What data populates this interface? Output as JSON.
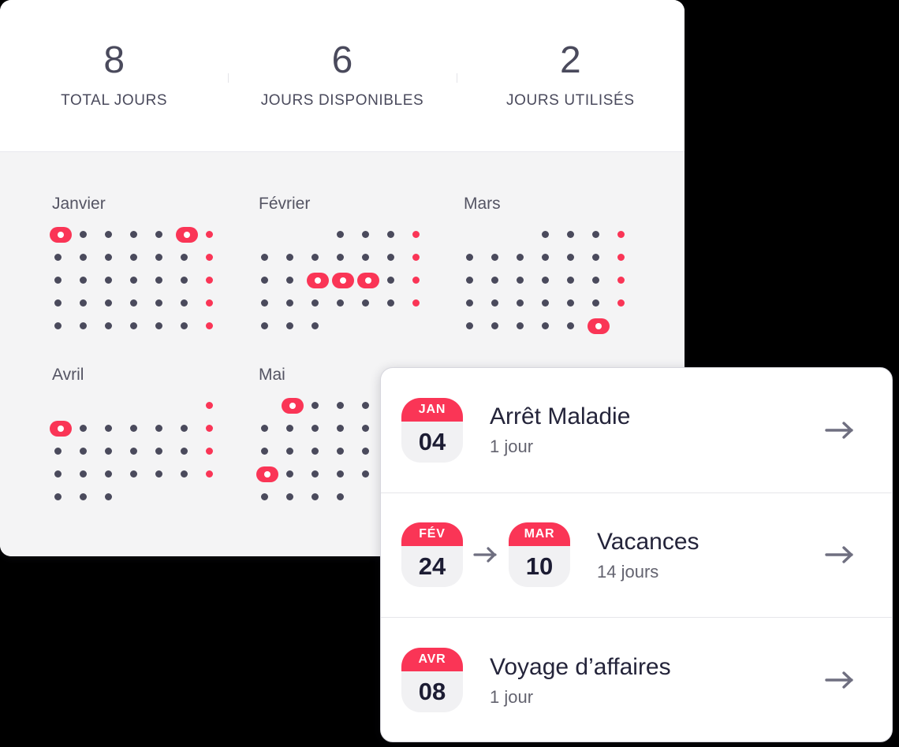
{
  "colors": {
    "accent": "#fa3556",
    "dot": "#4a4a5c",
    "panel_bg": "#f4f4f5",
    "card_bg": "#ffffff",
    "text_dark": "#24243a",
    "text_muted": "#63636f",
    "badge_body": "#f1f1f3"
  },
  "stats": [
    {
      "value": "8",
      "label": "TOTAL JOURS"
    },
    {
      "value": "6",
      "label": "JOURS DISPONIBLES"
    },
    {
      "value": "2",
      "label": "JOURS UTILISÉS"
    }
  ],
  "months": [
    {
      "name": "Janvier",
      "rows": [
        [
          "d",
          "d",
          "d",
          "d",
          "d",
          "d",
          "w"
        ],
        [
          "d",
          "d",
          "d",
          "d",
          "d",
          "d",
          "w"
        ],
        [
          "d",
          "d",
          "d",
          "d",
          "d",
          "d",
          "w"
        ],
        [
          "d",
          "d",
          "d",
          "d",
          "d",
          "d",
          "w"
        ],
        [
          "d",
          "d",
          "d",
          "d",
          "d",
          "d",
          "w"
        ]
      ],
      "highlights": [
        [
          0,
          0
        ],
        [
          0,
          5
        ]
      ]
    },
    {
      "name": "Février",
      "rows": [
        [
          "-",
          "-",
          "-",
          "d",
          "d",
          "d",
          "w"
        ],
        [
          "d",
          "d",
          "d",
          "d",
          "d",
          "d",
          "w"
        ],
        [
          "d",
          "d",
          "d",
          "d",
          "d",
          "d",
          "w"
        ],
        [
          "d",
          "d",
          "d",
          "d",
          "d",
          "d",
          "w"
        ],
        [
          "d",
          "d",
          "d",
          "-",
          "-",
          "-",
          "-"
        ]
      ],
      "highlights": [
        [
          2,
          2
        ],
        [
          2,
          3
        ],
        [
          2,
          4
        ]
      ]
    },
    {
      "name": "Mars",
      "rows": [
        [
          "-",
          "-",
          "-",
          "d",
          "d",
          "d",
          "w"
        ],
        [
          "d",
          "d",
          "d",
          "d",
          "d",
          "d",
          "w"
        ],
        [
          "d",
          "d",
          "d",
          "d",
          "d",
          "d",
          "w"
        ],
        [
          "d",
          "d",
          "d",
          "d",
          "d",
          "d",
          "w"
        ],
        [
          "d",
          "d",
          "d",
          "d",
          "d",
          "d",
          "-"
        ]
      ],
      "highlights": [
        [
          4,
          5
        ]
      ]
    },
    {
      "name": "Avril",
      "rows": [
        [
          "-",
          "-",
          "-",
          "-",
          "-",
          "-",
          "w"
        ],
        [
          "d",
          "d",
          "d",
          "d",
          "d",
          "d",
          "w"
        ],
        [
          "d",
          "d",
          "d",
          "d",
          "d",
          "d",
          "w"
        ],
        [
          "d",
          "d",
          "d",
          "d",
          "d",
          "d",
          "w"
        ],
        [
          "d",
          "d",
          "d",
          "-",
          "-",
          "-",
          "-"
        ]
      ],
      "highlights": [
        [
          1,
          0
        ]
      ]
    },
    {
      "name": "Mai",
      "rows": [
        [
          "-",
          "d",
          "d",
          "d",
          "d",
          "-",
          "-"
        ],
        [
          "d",
          "d",
          "d",
          "d",
          "d",
          "-",
          "-"
        ],
        [
          "d",
          "d",
          "d",
          "d",
          "d",
          "-",
          "-"
        ],
        [
          "d",
          "d",
          "d",
          "d",
          "d",
          "-",
          "-"
        ],
        [
          "d",
          "d",
          "d",
          "d",
          "-",
          "-",
          "-"
        ]
      ],
      "highlights": [
        [
          0,
          1
        ],
        [
          3,
          0
        ]
      ]
    }
  ],
  "events": [
    {
      "start": {
        "month": "JAN",
        "day": "04"
      },
      "end": null,
      "title": "Arrêt Maladie",
      "duration": "1 jour"
    },
    {
      "start": {
        "month": "FÉV",
        "day": "24"
      },
      "end": {
        "month": "MAR",
        "day": "10"
      },
      "title": "Vacances",
      "duration": "14 jours"
    },
    {
      "start": {
        "month": "AVR",
        "day": "08"
      },
      "end": null,
      "title": "Voyage d’affaires",
      "duration": "1 jour"
    }
  ]
}
